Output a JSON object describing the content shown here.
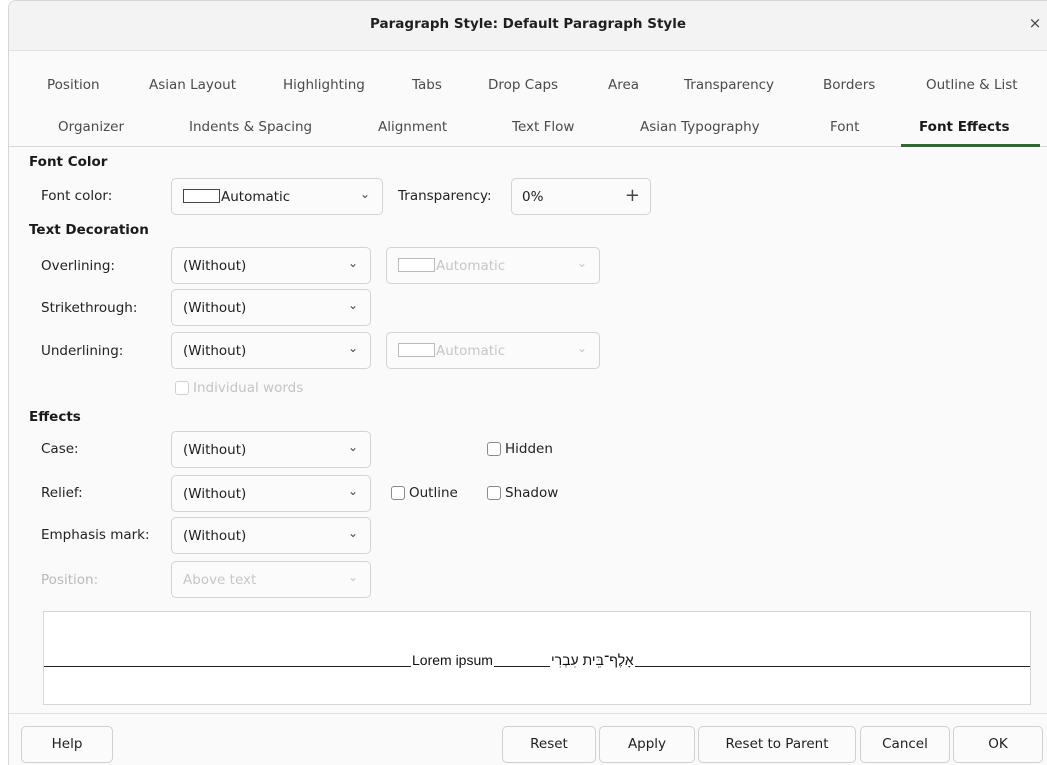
{
  "window": {
    "title": "Paragraph Style: Default Paragraph Style",
    "close_glyph": "×"
  },
  "tabs_row1": [
    "Position",
    "Asian Layout",
    "Highlighting",
    "Tabs",
    "Drop Caps",
    "Area",
    "Transparency",
    "Borders",
    "Outline & List"
  ],
  "tabs_row2": [
    "Organizer",
    "Indents & Spacing",
    "Alignment",
    "Text Flow",
    "Asian Typography",
    "Font",
    "Font Effects"
  ],
  "active_tab": "Font Effects",
  "font_color": {
    "section": "Font Color",
    "label": "Font color:",
    "value": "Automatic",
    "transparency_label": "Transparency:",
    "transparency_value": "0%"
  },
  "text_decoration": {
    "section": "Text Decoration",
    "overlining_label": "Overlining:",
    "overlining_value": "(Without)",
    "overlining_color": "Automatic",
    "strikethrough_label": "Strikethrough:",
    "strikethrough_value": "(Without)",
    "underlining_label": "Underlining:",
    "underlining_value": "(Without)",
    "underlining_color": "Automatic",
    "individual_words": "Individual words"
  },
  "effects": {
    "section": "Effects",
    "case_label": "Case:",
    "case_value": "(Without)",
    "relief_label": "Relief:",
    "relief_value": "(Without)",
    "emphasis_label": "Emphasis mark:",
    "emphasis_value": "(Without)",
    "position_label": "Position:",
    "position_value": "Above text",
    "hidden": "Hidden",
    "outline": "Outline",
    "shadow": "Shadow"
  },
  "preview": {
    "latin": "Lorem ipsum",
    "hebrew": "אָלֶף־בֵּית עִבְרִי"
  },
  "buttons": {
    "help": "Help",
    "reset": "Reset",
    "apply": "Apply",
    "reset_parent": "Reset to Parent",
    "cancel": "Cancel",
    "ok": "OK"
  },
  "colors": {
    "accent": "#2c6b2f",
    "disabled_text": "#b9b9b9"
  },
  "icons": {
    "chevron": "chevron-down-icon",
    "plus": "plus-icon",
    "close": "close-icon"
  }
}
